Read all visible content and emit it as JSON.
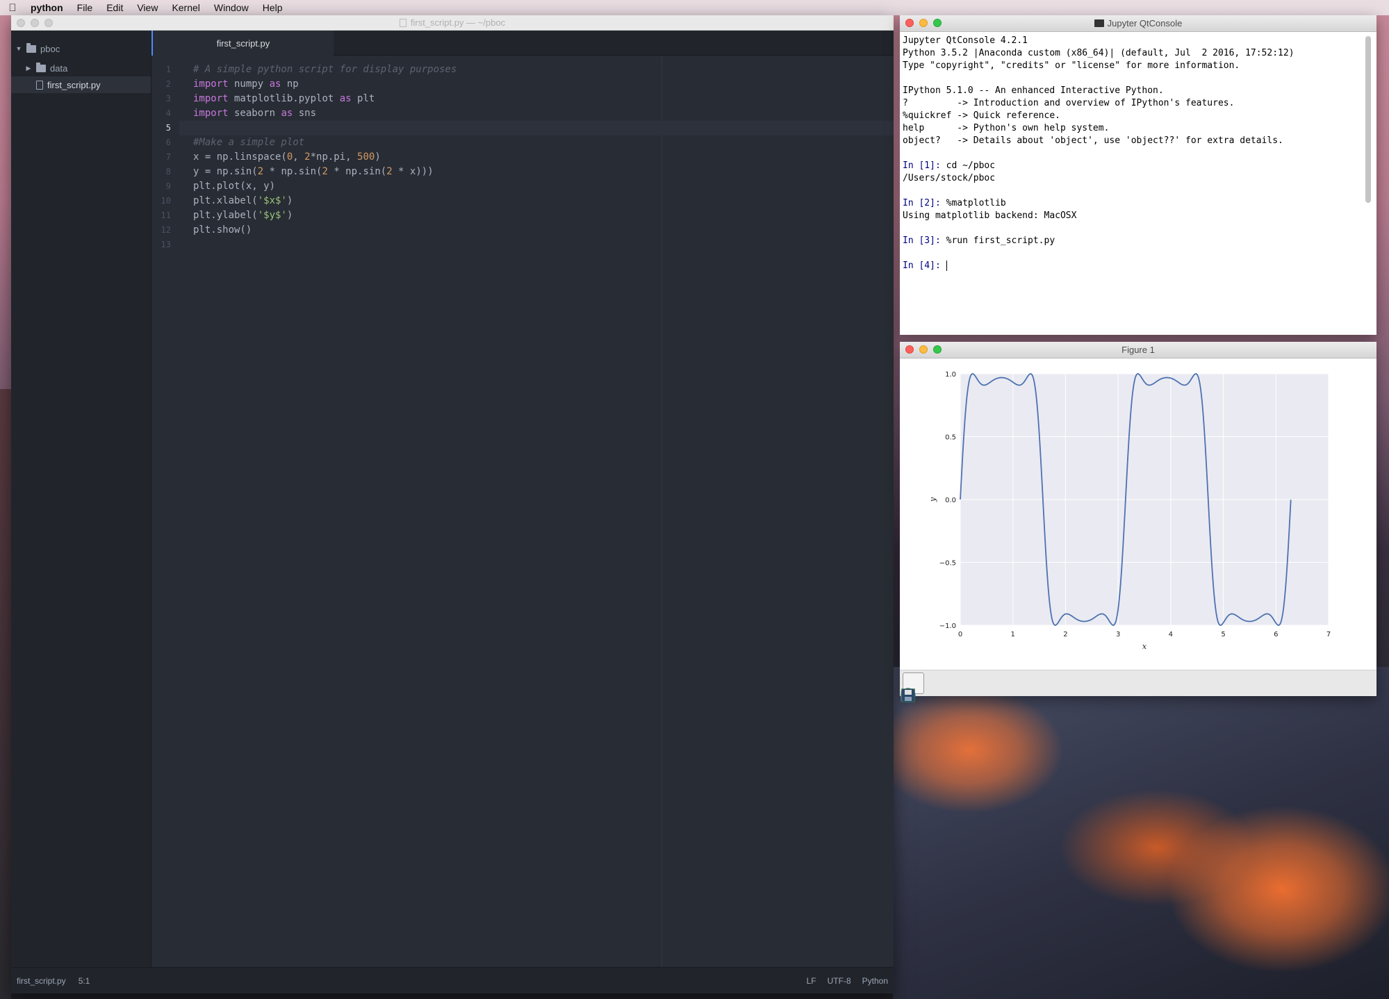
{
  "menubar": {
    "app_name": "python",
    "items": [
      "File",
      "Edit",
      "View",
      "Kernel",
      "Window",
      "Help"
    ]
  },
  "atom": {
    "title": "first_script.py — ~/pboc",
    "tree": {
      "root": "pboc",
      "folder": "data",
      "file": "first_script.py"
    },
    "tab_label": "first_script.py",
    "line_numbers": [
      "1",
      "2",
      "3",
      "4",
      "5",
      "6",
      "7",
      "8",
      "9",
      "10",
      "11",
      "12",
      "13"
    ],
    "active_line": 5,
    "code_lines": [
      "# A simple python script for display purposes",
      "import numpy as np",
      "import matplotlib.pyplot as plt",
      "import seaborn as sns",
      "",
      "#Make a simple plot",
      "x = np.linspace(0, 2*np.pi, 500)",
      "y = np.sin(2 * np.sin(2 * np.sin(2 * x)))",
      "plt.plot(x, y)",
      "plt.xlabel('$x$')",
      "plt.ylabel('$y$')",
      "plt.show()",
      ""
    ],
    "status": {
      "file": "first_script.py",
      "cursor": "5:1",
      "line_ending": "LF",
      "encoding": "UTF-8",
      "grammar": "Python"
    }
  },
  "qtconsole": {
    "title": "Jupyter QtConsole",
    "banner": [
      "Jupyter QtConsole 4.2.1",
      "Python 3.5.2 |Anaconda custom (x86_64)| (default, Jul  2 2016, 17:52:12)",
      "Type \"copyright\", \"credits\" or \"license\" for more information.",
      "",
      "IPython 5.1.0 -- An enhanced Interactive Python.",
      "?         -> Introduction and overview of IPython's features.",
      "%quickref -> Quick reference.",
      "help      -> Python's own help system.",
      "object?   -> Details about 'object', use 'object??' for extra details."
    ],
    "cells": [
      {
        "prompt": "In [1]: ",
        "input": "cd ~/pboc",
        "output": "/Users/stock/pboc"
      },
      {
        "prompt": "In [2]: ",
        "input": "%matplotlib",
        "output": "Using matplotlib backend: MacOSX"
      },
      {
        "prompt": "In [3]: ",
        "input": "%run first_script.py",
        "output": ""
      },
      {
        "prompt": "In [4]: ",
        "input": "",
        "output": ""
      }
    ]
  },
  "figure": {
    "title": "Figure 1",
    "toolbar": [
      "home-icon",
      "back-icon",
      "forward-icon",
      "pan-icon",
      "zoom-icon",
      "subplots-icon",
      "save-icon"
    ]
  },
  "chart_data": {
    "type": "line",
    "function": "y = sin(2*sin(2*sin(2*x)))",
    "x_range": [
      0,
      6.283
    ],
    "n_points": 500,
    "xlabel": "x",
    "ylabel": "y",
    "xlim": [
      0,
      7
    ],
    "ylim": [
      -1.0,
      1.0
    ],
    "xticks": [
      "0",
      "1",
      "2",
      "3",
      "4",
      "5",
      "6",
      "7"
    ],
    "yticks": [
      "1.0",
      "0.5",
      "0.0",
      "−0.5",
      "−1.0"
    ],
    "line_color": "#4c72b0",
    "background": "#eaeaf2",
    "grid": true
  }
}
